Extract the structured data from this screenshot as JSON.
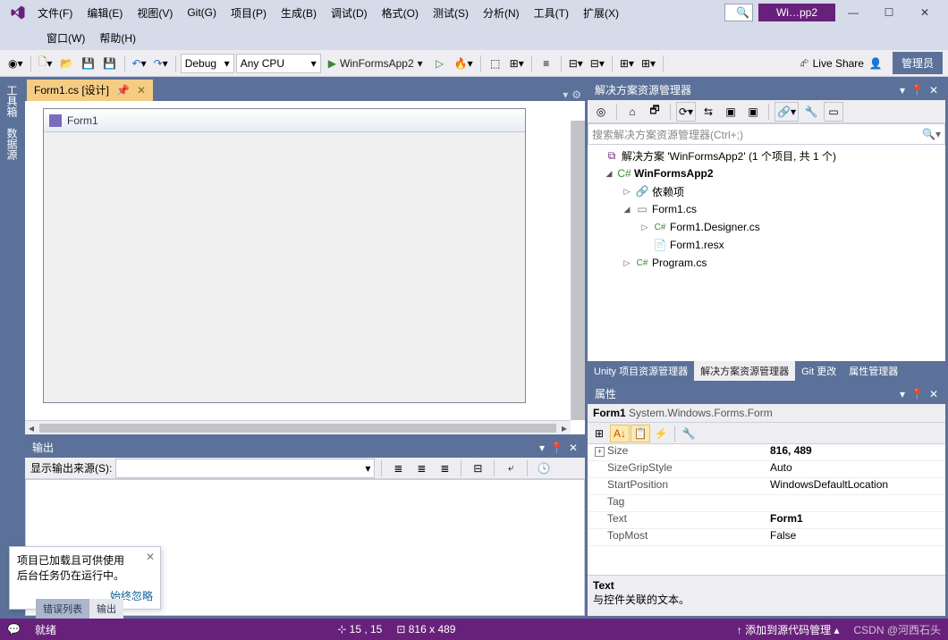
{
  "title": {
    "app_short": "Wi…pp2"
  },
  "menu": [
    "文件(F)",
    "编辑(E)",
    "视图(V)",
    "Git(G)",
    "项目(P)",
    "生成(B)",
    "调试(D)",
    "格式(O)",
    "测试(S)",
    "分析(N)",
    "工具(T)",
    "扩展(X)",
    "窗口(W)",
    "帮助(H)"
  ],
  "toolbar": {
    "config": "Debug",
    "platform": "Any CPU",
    "start_target": "WinFormsApp2",
    "live_share": "Live Share",
    "admin": "管理员"
  },
  "side_tabs": [
    "工具箱",
    "数据源"
  ],
  "doc_tab": {
    "label": "Form1.cs [设计]"
  },
  "designer": {
    "form_title": "Form1"
  },
  "output": {
    "panel_title": "输出",
    "source_label": "显示输出来源(S):"
  },
  "solution_explorer": {
    "title": "解决方案资源管理器",
    "search_placeholder": "搜索解决方案资源管理器(Ctrl+;)",
    "root": "解决方案 'WinFormsApp2' (1 个项目, 共 1 个)",
    "project": "WinFormsApp2",
    "deps": "依赖项",
    "form": "Form1.cs",
    "designer_file": "Form1.Designer.cs",
    "resx": "Form1.resx",
    "program": "Program.cs",
    "tabs": [
      "Unity 项目资源管理器",
      "解决方案资源管理器",
      "Git 更改",
      "属性管理器"
    ]
  },
  "properties": {
    "title": "属性",
    "object": "Form1",
    "type": "System.Windows.Forms.Form",
    "rows": [
      {
        "name": "Size",
        "value": "816, 489",
        "bold": true,
        "expand": true
      },
      {
        "name": "SizeGripStyle",
        "value": "Auto"
      },
      {
        "name": "StartPosition",
        "value": "WindowsDefaultLocation"
      },
      {
        "name": "Tag",
        "value": ""
      },
      {
        "name": "Text",
        "value": "Form1",
        "bold": true
      },
      {
        "name": "TopMost",
        "value": "False"
      }
    ],
    "desc_name": "Text",
    "desc_text": "与控件关联的文本。"
  },
  "popup": {
    "line1": "项目已加载且可供使用",
    "line2": "后台任务仍在运行中。",
    "link": "始终忽略"
  },
  "bottom_tabs": [
    "错误列表",
    "输出"
  ],
  "status": {
    "ready": "就绪",
    "pos": "15 , 15",
    "size": "816 x 489",
    "add_source": "添加到源代码管理",
    "watermark": "CSDN @河西石头"
  }
}
